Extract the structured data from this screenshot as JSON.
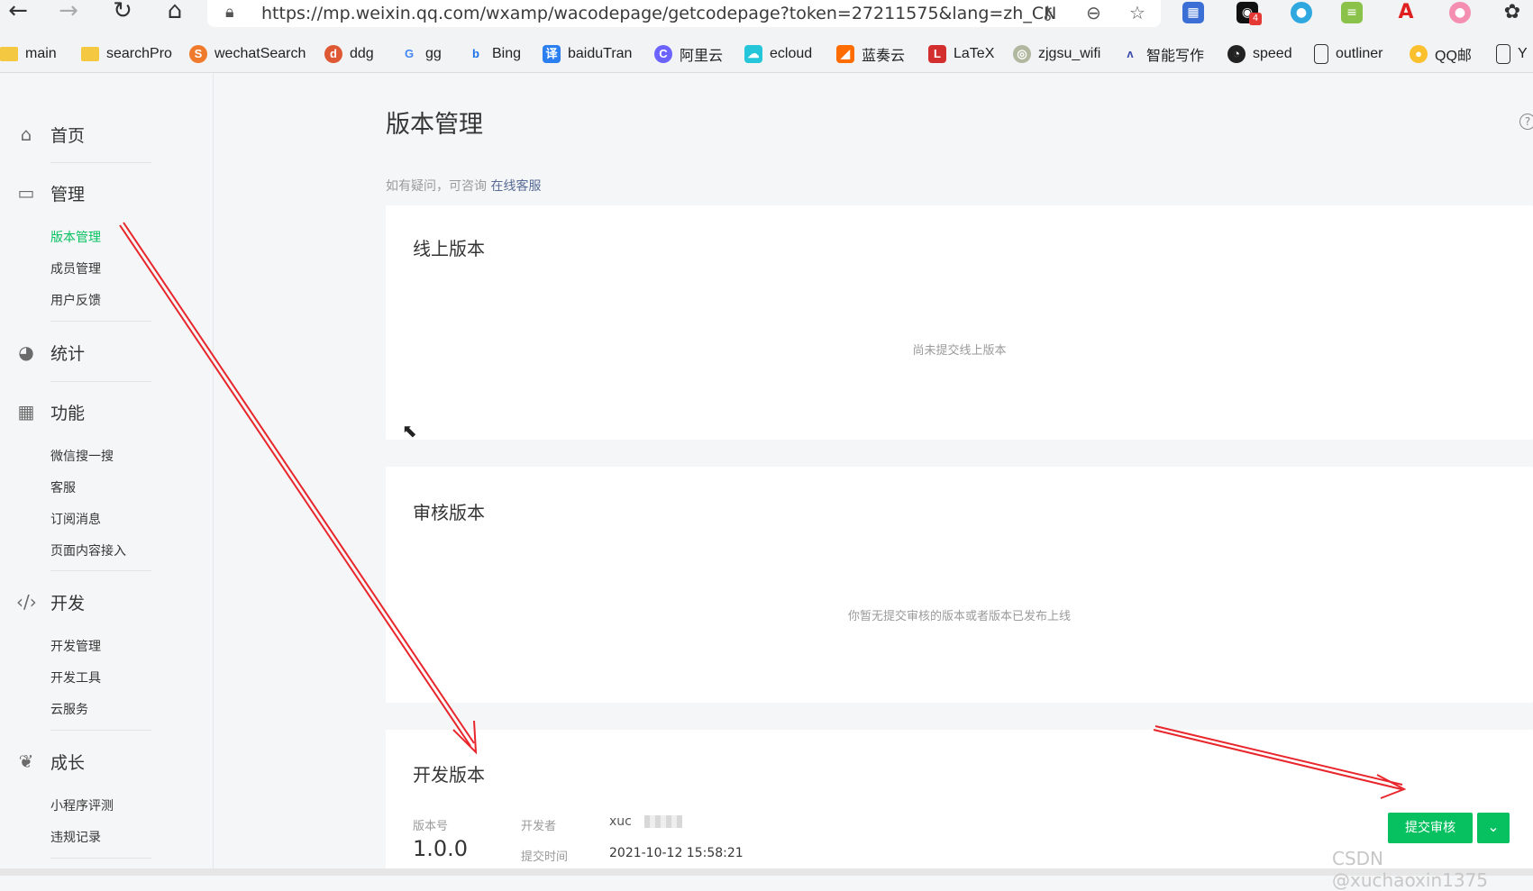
{
  "browser": {
    "url": "https://mp.weixin.qq.com/wxamp/wacodepage/getcodepage?token=27211575&lang=zh_CN",
    "extension_badge": "4",
    "bookmarks": [
      "main",
      "searchPro",
      "wechatSearch",
      "ddg",
      "gg",
      "Bing",
      "baiduTran",
      "阿里云",
      "ecloud",
      "蓝奏云",
      "LaTeX",
      "zjgsu_wifi",
      "智能写作",
      "speed",
      "outliner",
      "QQ邮",
      "Y"
    ]
  },
  "sidebar": {
    "home": "首页",
    "manage": "管理",
    "manage_items": [
      "版本管理",
      "成员管理",
      "用户反馈"
    ],
    "stats": "统计",
    "features": "功能",
    "features_items": [
      "微信搜一搜",
      "客服",
      "订阅消息",
      "页面内容接入"
    ],
    "dev": "开发",
    "dev_items": [
      "开发管理",
      "开发工具",
      "云服务"
    ],
    "growth": "成长",
    "growth_items": [
      "小程序评测",
      "违规记录"
    ]
  },
  "main": {
    "title": "版本管理",
    "help_icon": "?",
    "hint_prefix": "如有疑问，可咨询",
    "hint_link": "在线客服",
    "online": {
      "title": "线上版本",
      "empty": "尚未提交线上版本"
    },
    "review": {
      "title": "审核版本",
      "empty": "你暂无提交审核的版本或者版本已发布上线"
    },
    "dev": {
      "title": "开发版本",
      "version_label": "版本号",
      "version": "1.0.0",
      "developer_label": "开发者",
      "developer": "xuc",
      "time_label": "提交时间",
      "time": "2021-10-12 15:58:21",
      "submit_button": "提交审核"
    }
  },
  "watermark": "CSDN @xuchaoxin1375",
  "colors": {
    "accent": "#07c160",
    "link": "#576b95",
    "annotation": "#e8262b"
  }
}
